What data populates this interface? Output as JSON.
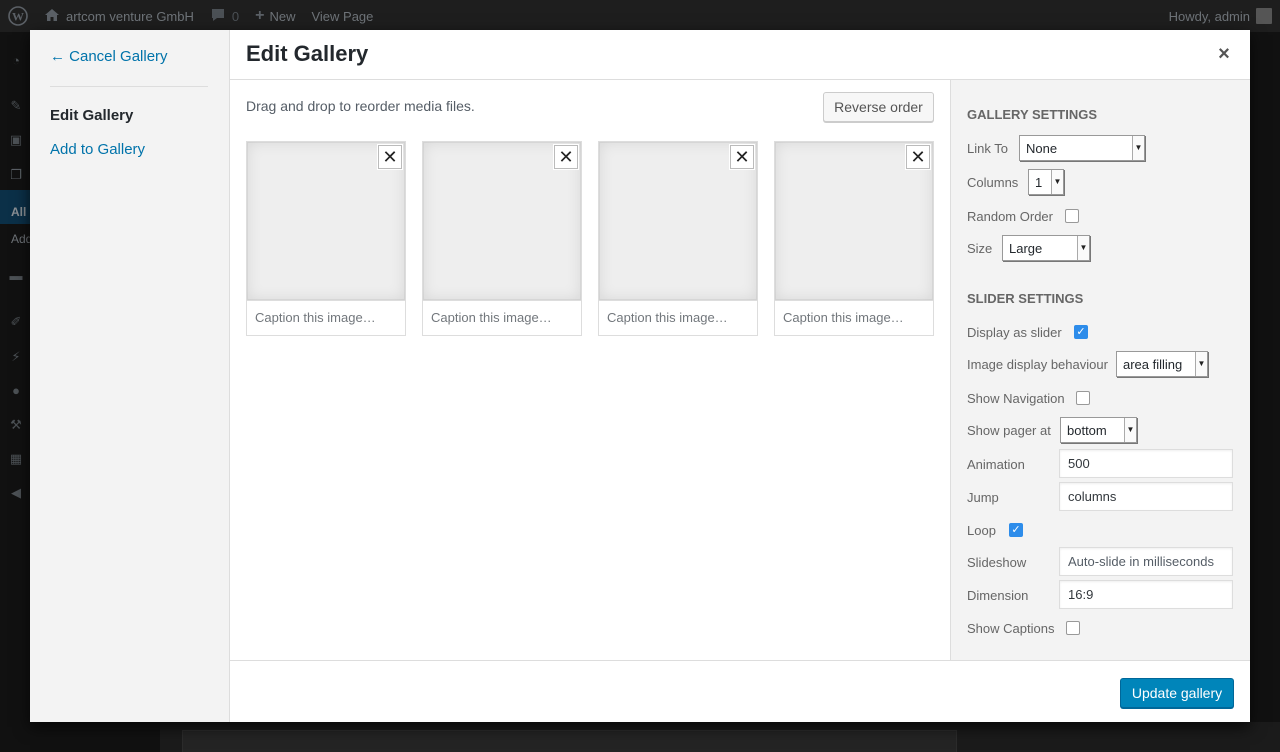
{
  "admin_bar": {
    "site_name": "artcom venture GmbH",
    "comments_count": "0",
    "new_label": "New",
    "view_page_label": "View Page",
    "greeting": "Howdy, admin"
  },
  "admin_menu": {
    "all_label": "All",
    "add_label": "Add"
  },
  "modal": {
    "cancel_label": "← Cancel Gallery",
    "menu_items": [
      "Edit Gallery",
      "Add to Gallery"
    ],
    "title": "Edit Gallery",
    "close_glyph": "×"
  },
  "content": {
    "instructions": "Drag and drop to reorder media files.",
    "reverse_label": "Reverse order",
    "attachments": [
      {
        "caption_placeholder": "Caption this image…"
      },
      {
        "caption_placeholder": "Caption this image…"
      },
      {
        "caption_placeholder": "Caption this image…"
      },
      {
        "caption_placeholder": "Caption this image…"
      }
    ],
    "remove_glyph": "✕"
  },
  "gallery_settings": {
    "heading": "Gallery Settings",
    "link_to_label": "Link To",
    "link_to_value": "None",
    "columns_label": "Columns",
    "columns_value": "1",
    "random_order_label": "Random Order",
    "random_order": false,
    "size_label": "Size",
    "size_value": "Large"
  },
  "slider_settings": {
    "heading": "Slider Settings",
    "display_as_slider_label": "Display as slider",
    "display_as_slider": true,
    "image_display_label": "Image display behaviour",
    "image_display_value": "area filling",
    "show_navigation_label": "Show Navigation",
    "show_navigation": false,
    "show_pager_label": "Show pager at",
    "show_pager_value": "bottom",
    "animation_label": "Animation",
    "animation_value": "500",
    "jump_label": "Jump",
    "jump_value": "columns",
    "loop_label": "Loop",
    "loop": true,
    "slideshow_label": "Slideshow",
    "slideshow_placeholder": "Auto-slide in milliseconds",
    "dimension_label": "Dimension",
    "dimension_value": "16:9",
    "show_captions_label": "Show Captions",
    "show_captions": false
  },
  "footer": {
    "update_label": "Update gallery"
  },
  "colors": {
    "primary": "#0085ba",
    "link": "#0073aa",
    "checkbox": "#2d8cea",
    "admin_bar": "#1e1e1e"
  }
}
